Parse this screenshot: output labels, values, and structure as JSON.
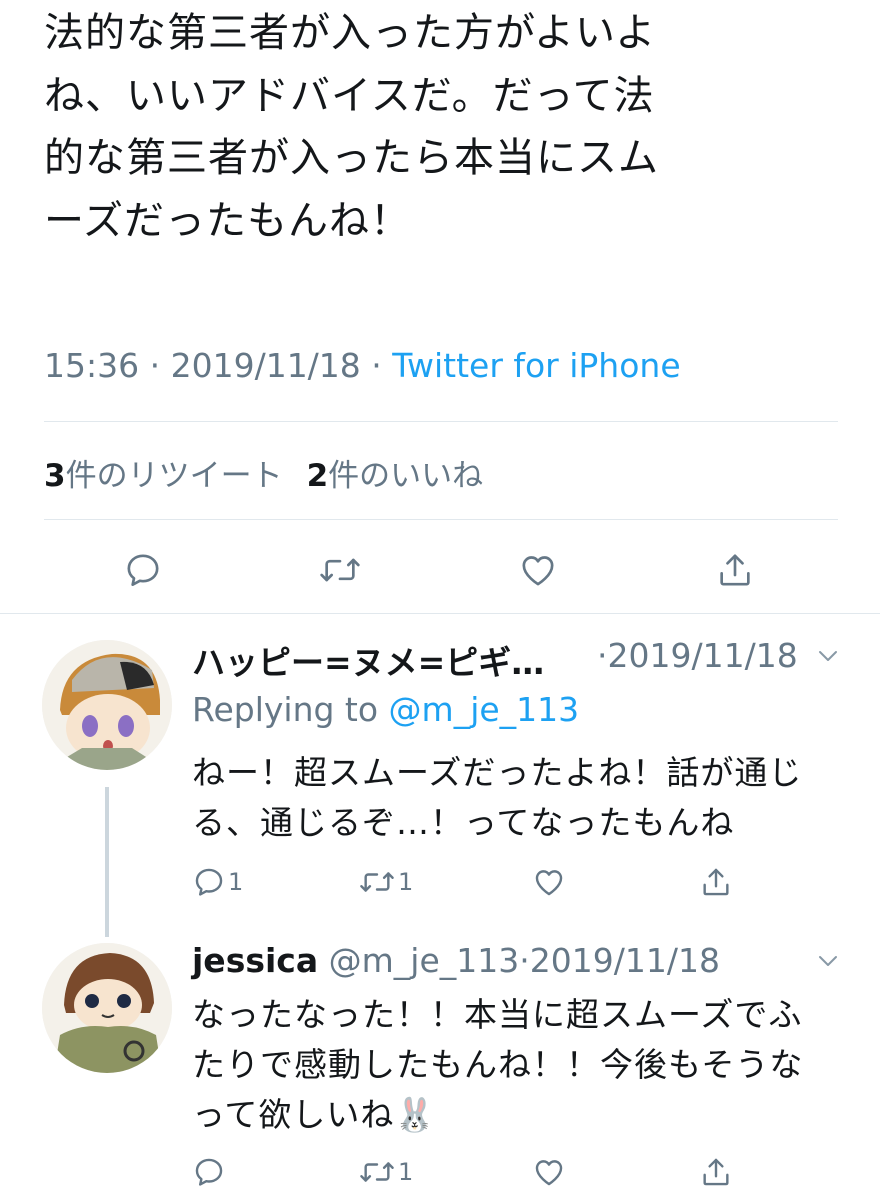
{
  "main_tweet": {
    "text_lines": [
      "法的な第三者が入った方がよいよ",
      "ね、いいアドバイスだ。だって法",
      "的な第三者が入ったら本当にスム",
      "ーズだったもんね！"
    ],
    "time": "15:36",
    "date": "2019/11/18",
    "source": "Twitter for iPhone",
    "retweet_count": "3",
    "retweet_label": "件のリツイート",
    "like_count": "2",
    "like_label": "件のいいね"
  },
  "replies": [
    {
      "name": "ハッピー=ヌメ=ピギ…",
      "handle": "",
      "date": "2019/11/18",
      "replying_prefix": "Replying to ",
      "replying_to": "@m_je_113",
      "text_lines": [
        "ねー！超スムーズだったよね！話が通じ",
        "る、通じるぞ…！ってなったもんね"
      ],
      "reply_count": "1",
      "retweet_count": "1",
      "like_count": ""
    },
    {
      "name": "jessica",
      "handle": "@m_je_113",
      "date": "2019/11/18",
      "text_lines": [
        "なったなった！！本当に超スムーズでふ",
        "たりで感動したもんね！！今後もそうな",
        "って欲しいね🐰"
      ],
      "reply_count": "",
      "retweet_count": "1",
      "like_count": ""
    }
  ],
  "icons": {
    "reply": "reply-icon",
    "retweet": "retweet-icon",
    "like": "heart-icon",
    "share": "share-icon",
    "chevron": "chevron-down-icon"
  },
  "colors": {
    "accent": "#1da1f2",
    "secondary_text": "#657786",
    "divider": "#e1e8ed",
    "icon": "#657786"
  }
}
